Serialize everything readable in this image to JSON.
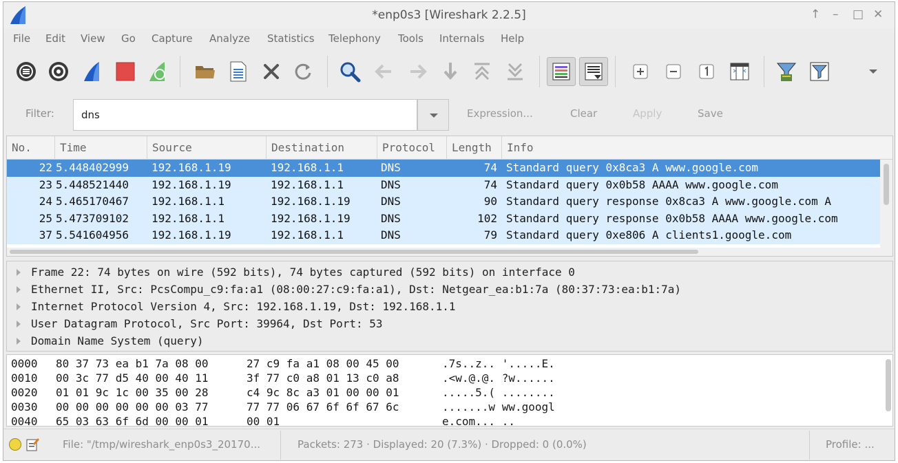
{
  "window": {
    "title": "*enp0s3 [Wireshark 2.2.5]",
    "controls": [
      "↑",
      "–",
      "□",
      "✕"
    ]
  },
  "menu": [
    "File",
    "Edit",
    "View",
    "Go",
    "Capture",
    "Analyze",
    "Statistics",
    "Telephony",
    "Tools",
    "Internals",
    "Help"
  ],
  "toolbar": {
    "icons": [
      "interfaces-icon",
      "capture-options-icon",
      "start-capture-icon",
      "stop-capture-icon",
      "restart-capture-icon",
      "open-file-icon",
      "save-file-icon",
      "close-file-icon",
      "reload-file-icon",
      "find-packet-icon",
      "go-back-icon",
      "go-forward-icon",
      "go-to-packet-icon",
      "go-first-icon",
      "go-last-icon",
      "colorize-icon",
      "auto-scroll-icon",
      "zoom-in-icon",
      "zoom-out-icon",
      "normal-size-icon",
      "resize-columns-icon",
      "capture-filters-icon",
      "display-filters-icon",
      "more-icon"
    ]
  },
  "filter": {
    "label": "Filter:",
    "value": "dns",
    "expression": "Expression...",
    "clear": "Clear",
    "apply": "Apply",
    "save": "Save"
  },
  "packet_list": {
    "columns": [
      "No.",
      "Time",
      "Source",
      "Destination",
      "Protocol",
      "Length",
      "Info"
    ],
    "rows": [
      {
        "no": "22",
        "time": "5.448402999",
        "source": "192.168.1.19",
        "destination": "192.168.1.1",
        "protocol": "DNS",
        "length": "74",
        "info": "Standard query 0x8ca3 A www.google.com",
        "selected": true
      },
      {
        "no": "23",
        "time": "5.448521440",
        "source": "192.168.1.19",
        "destination": "192.168.1.1",
        "protocol": "DNS",
        "length": "74",
        "info": "Standard query 0x0b58 AAAA www.google.com",
        "selected": false
      },
      {
        "no": "24",
        "time": "5.465170467",
        "source": "192.168.1.1",
        "destination": "192.168.1.19",
        "protocol": "DNS",
        "length": "90",
        "info": "Standard query response 0x8ca3 A www.google.com A",
        "selected": false
      },
      {
        "no": "25",
        "time": "5.473709102",
        "source": "192.168.1.1",
        "destination": "192.168.1.19",
        "protocol": "DNS",
        "length": "102",
        "info": "Standard query response 0x0b58 AAAA www.google.com",
        "selected": false
      },
      {
        "no": "37",
        "time": "5.541604956",
        "source": "192.168.1.19",
        "destination": "192.168.1.1",
        "protocol": "DNS",
        "length": "79",
        "info": "Standard query 0xe806 A clients1.google.com",
        "selected": false
      }
    ]
  },
  "details": [
    "Frame 22: 74 bytes on wire (592 bits), 74 bytes captured (592 bits) on interface 0",
    "Ethernet II, Src: PcsCompu_c9:fa:a1 (08:00:27:c9:fa:a1), Dst: Netgear_ea:b1:7a (80:37:73:ea:b1:7a)",
    "Internet Protocol Version 4, Src: 192.168.1.19, Dst: 192.168.1.1",
    "User Datagram Protocol, Src Port: 39964, Dst Port: 53",
    "Domain Name System (query)"
  ],
  "bytes": [
    {
      "offset": "0000",
      "hex1": "80 37 73 ea b1 7a 08 00",
      "hex2": "27 c9 fa a1 08 00 45 00",
      "ascii": ".7s..z.. '.....E."
    },
    {
      "offset": "0010",
      "hex1": "00 3c 77 d5 40 00 40 11",
      "hex2": "3f 77 c0 a8 01 13 c0 a8",
      "ascii": ".<w.@.@. ?w......"
    },
    {
      "offset": "0020",
      "hex1": "01 01 9c 1c 00 35 00 28",
      "hex2": "c4 9c 8c a3 01 00 00 01",
      "ascii": ".....5.( ........"
    },
    {
      "offset": "0030",
      "hex1": "00 00 00 00 00 00 03 77",
      "hex2": "77 77 06 67 6f 6f 67 6c",
      "ascii": ".......w ww.googl"
    },
    {
      "offset": "0040",
      "hex1": "65 03 63 6f 6d 00 00 01",
      "hex2": "00 01",
      "ascii": "e.com... .."
    }
  ],
  "status": {
    "file": "File: \"/tmp/wireshark_enp0s3_20170...",
    "packets": "Packets: 273 · Displayed: 20 (7.3%) · Dropped: 0 (0.0%)",
    "profile": "Profile: ..."
  }
}
